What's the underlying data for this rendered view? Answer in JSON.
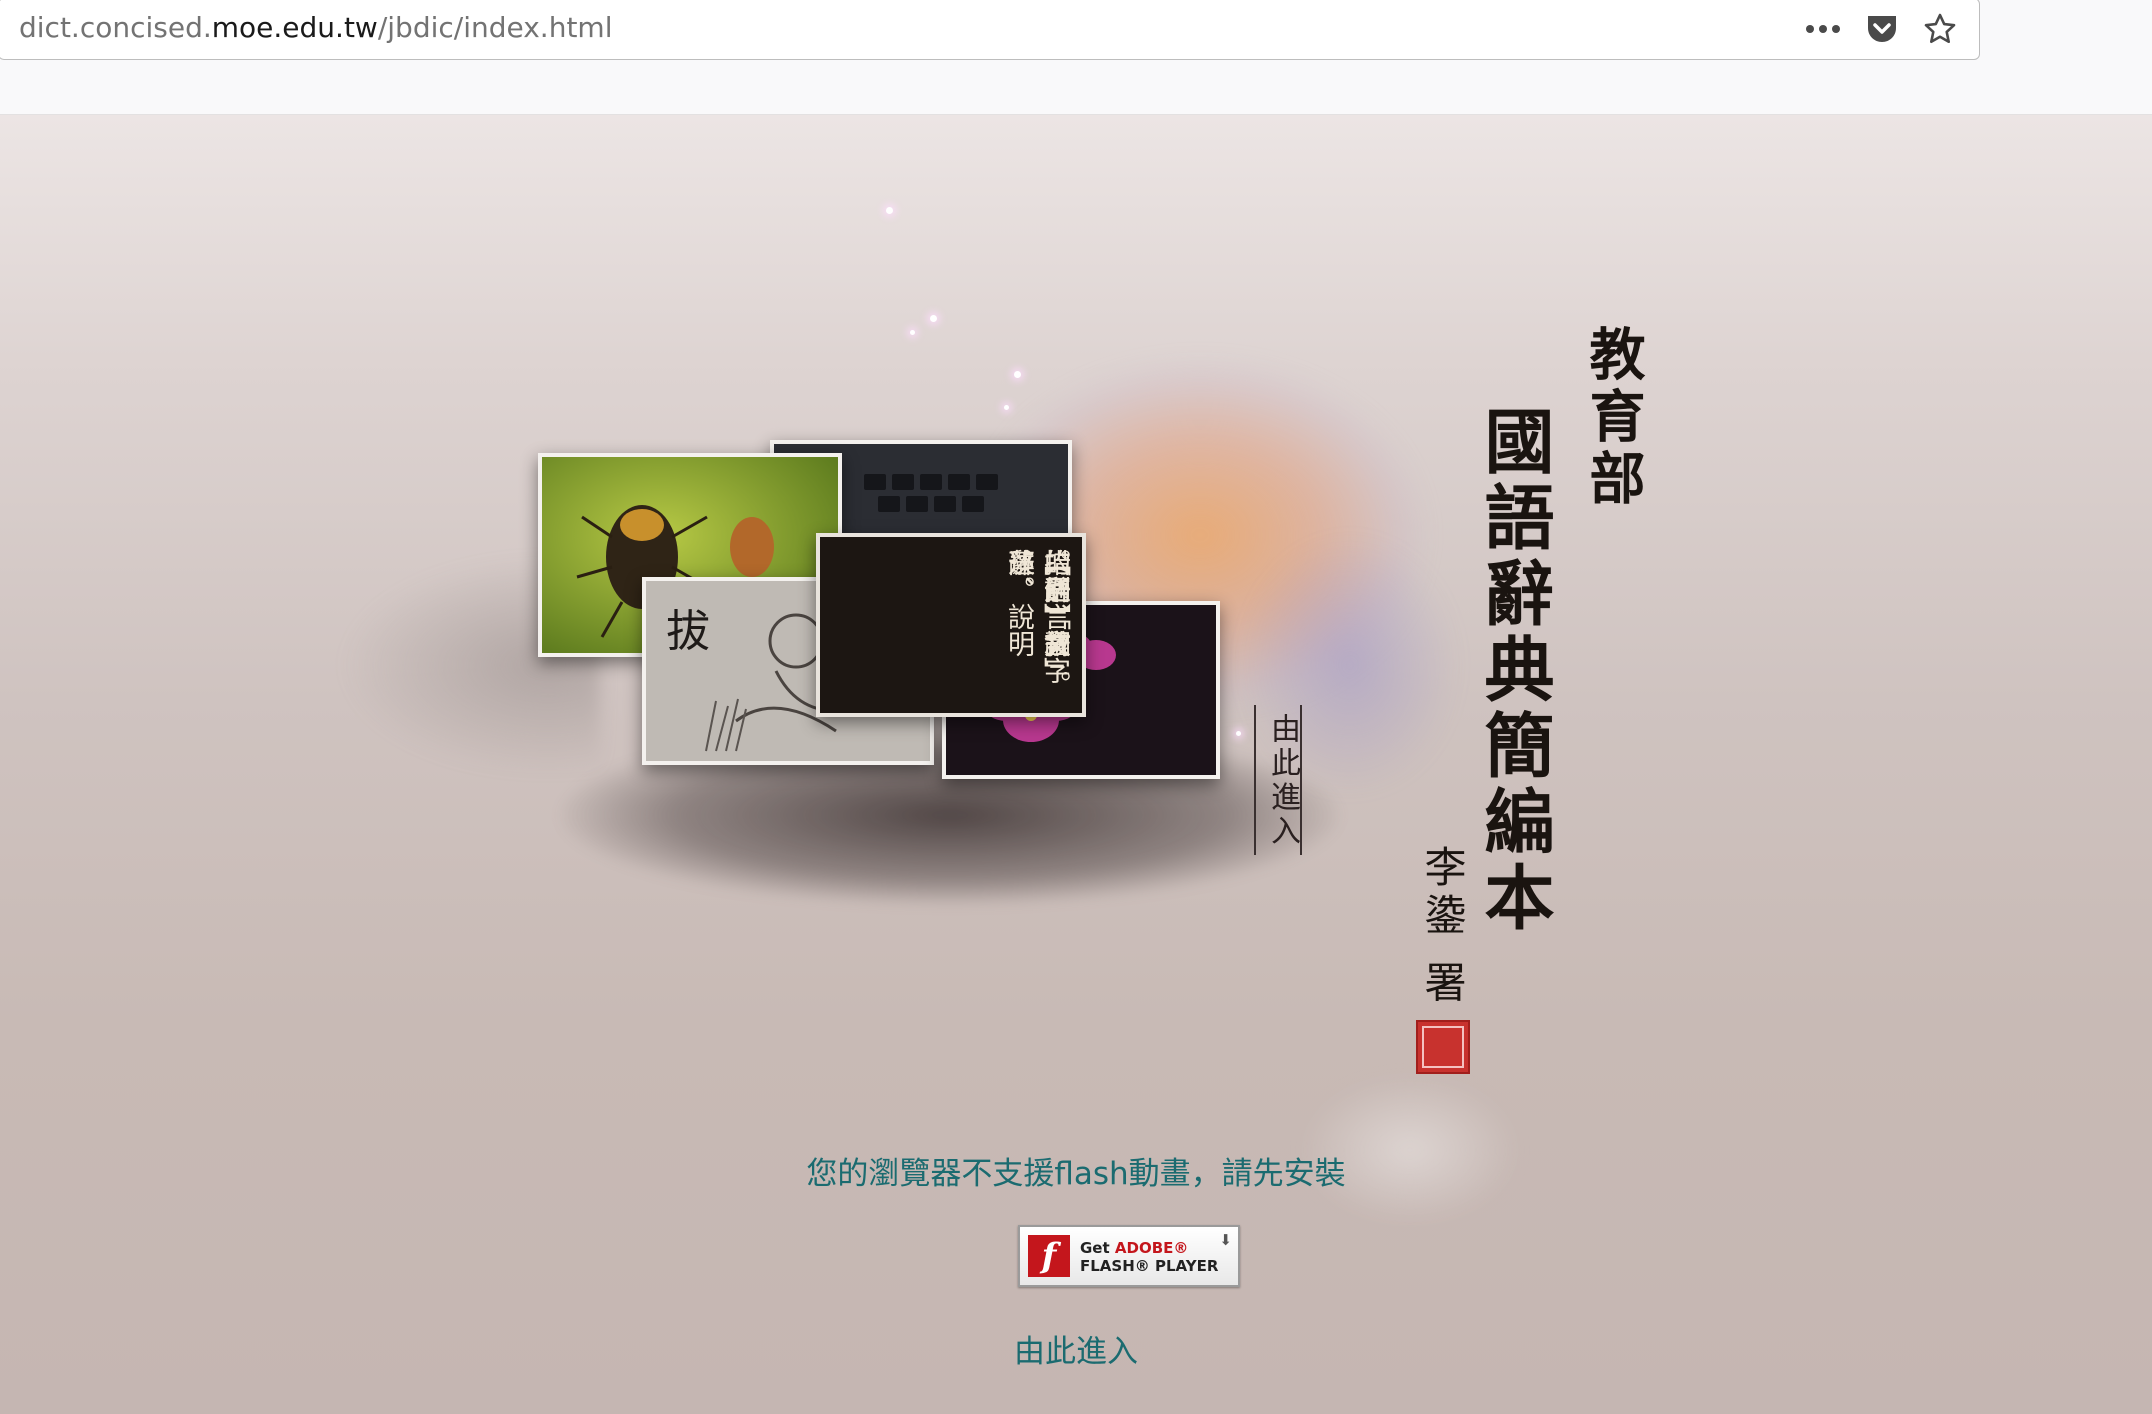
{
  "browser": {
    "url_prefix": "dict.concised.",
    "url_host": "moe.edu.tw",
    "url_path": "/jbdic/index.html"
  },
  "hero": {
    "org_title": "教育部",
    "main_title": "國語辭典簡編本",
    "author": "李鍌 署",
    "entry_badge": "由此進入",
    "card_photo_char": "拔",
    "card_text_lines": [
      "【辭】敘述、說明",
      "的語言文字",
      "。通「詞」。",
      "「例」言辭、",
      "措辭、辭藻。"
    ]
  },
  "notice": "您的瀏覽器不支援flash動畫，請先安裝",
  "flash_button": {
    "get": "Get",
    "adobe": "ADOBE®",
    "product": "FLASH® PLAYER",
    "logo_glyph": "f"
  },
  "enter_link": "由此進入",
  "colors": {
    "link": "#1b6b70",
    "page_bg": "#c8bab5",
    "stamp_red": "#c8322e"
  }
}
